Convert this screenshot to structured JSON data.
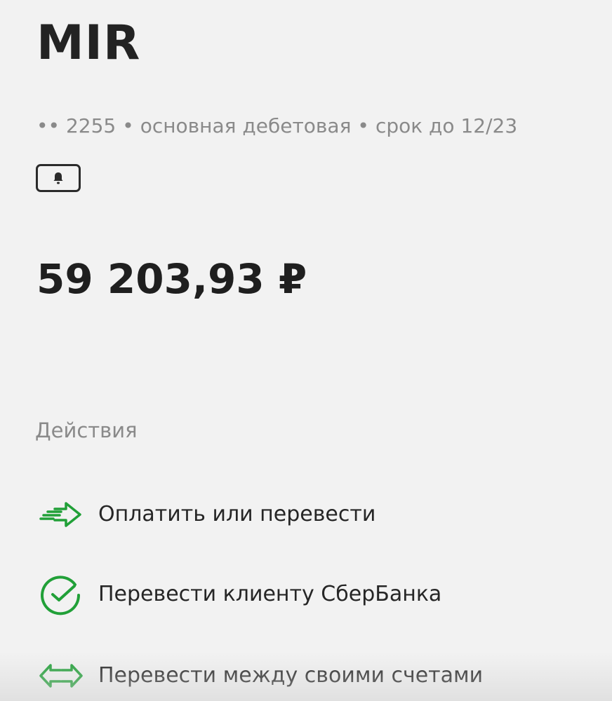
{
  "card": {
    "title": "MIR",
    "number_dots": "••",
    "number_last4": "2255",
    "type": "основная дебетовая",
    "expiry": "срок до 12/23",
    "separator": "•",
    "notify_icon": "bell-icon"
  },
  "balance": {
    "amount": "59 203,93 ₽"
  },
  "actions": {
    "title": "Действия",
    "items": [
      {
        "label": "Оплатить или перевести",
        "icon": "transfer-arrow-icon"
      },
      {
        "label": "Перевести клиенту СберБанка",
        "icon": "sber-logo-icon"
      },
      {
        "label": "Перевести между своими счетами",
        "icon": "swap-arrows-icon"
      }
    ]
  },
  "colors": {
    "accent": "#21a038",
    "text": "#222222",
    "muted": "#8a8a8a",
    "background": "#f2f2f2"
  }
}
